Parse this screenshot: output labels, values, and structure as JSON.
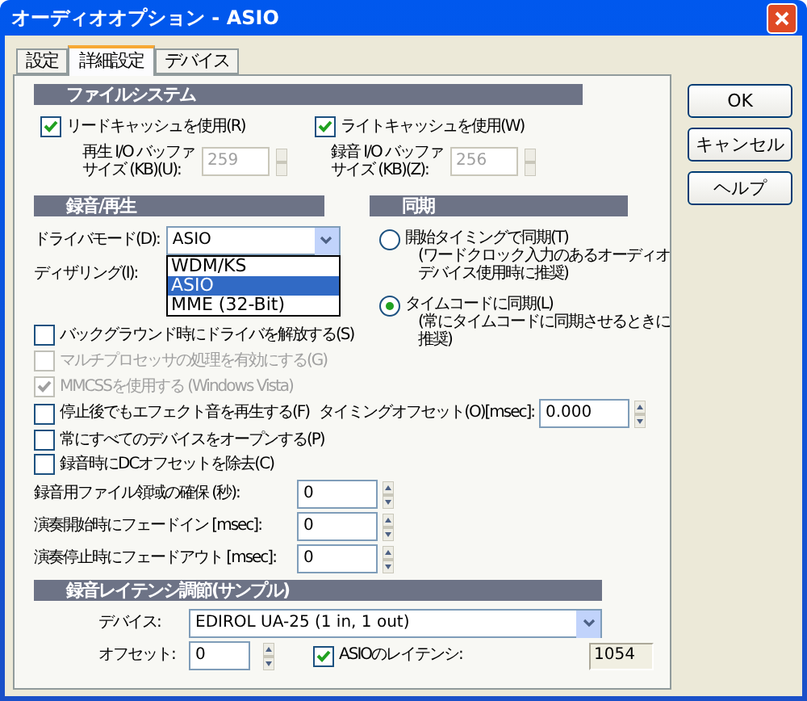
{
  "window": {
    "title": "オーディオオプション - ASIO"
  },
  "tabs": [
    {
      "label": "設定",
      "selected": false
    },
    {
      "label": "詳細設定",
      "selected": true
    },
    {
      "label": "デバイス",
      "selected": false
    }
  ],
  "buttons": [
    "OK",
    "キャンセル",
    "ヘルプ"
  ],
  "file_system": {
    "header": "ファイルシステム",
    "checkboxes": [
      {
        "label": "リードキャッシュを使用(R)",
        "checked": true
      },
      {
        "label": "ライトキャッシュを使用(W)",
        "checked": true
      }
    ],
    "buffers": [
      {
        "lines": [
          "再生 I/O バッファ",
          "サイズ (KB)(U):"
        ],
        "value": "259",
        "disabled": true
      },
      {
        "lines": [
          "録音 I/O バッファ",
          "サイズ (KB)(Z):"
        ],
        "value": "256",
        "disabled": true
      }
    ]
  },
  "recording": {
    "header": "録音/再生",
    "driver_mode": {
      "label": "ドライバモード(D):",
      "value": "ASIO",
      "options": [
        {
          "label": "WDM/KS",
          "selected": false
        },
        {
          "label": "ASIO",
          "selected": true
        },
        {
          "label": "MME (32-Bit)",
          "selected": false
        }
      ]
    },
    "dithering": {
      "label": "ディザリング(I):"
    },
    "checkboxes": [
      {
        "label": "バックグラウンド時にドライバを解放する(S)",
        "checked": false,
        "disabled": false
      },
      {
        "label": "マルチプロセッサの処理を有効にする(G)",
        "checked": false,
        "disabled": true
      },
      {
        "label": "MMCSSを使用する (Windows Vista)",
        "checked": true,
        "disabled": true
      },
      {
        "label": "停止後でもエフェクト音を再生する(F)",
        "checked": false,
        "disabled": false
      },
      {
        "label": "常にすべてのデバイスをオープンする(P)",
        "checked": false,
        "disabled": false
      },
      {
        "label": "録音時にDCオフセットを除去(C)",
        "checked": false,
        "disabled": false
      }
    ]
  },
  "sync": {
    "header": "同期",
    "radios": [
      {
        "lines": [
          "開始タイミングで同期(T)",
          "(ワードクロック入力のあるオーディオ",
          "デバイス使用時に推奨)"
        ],
        "selected": false
      },
      {
        "lines": [
          "タイムコードに同期(L)",
          "(常にタイムコードに同期させるときに",
          "推奨)"
        ],
        "selected": true
      }
    ],
    "timing_offset": {
      "label": "タイミングオフセット(O)[msec]:",
      "value": "0.000"
    }
  },
  "fields": [
    {
      "label": "録音用ファイル領域の確保 (秒):",
      "value": "0"
    },
    {
      "label": "演奏開始時にフェードイン [msec]:",
      "value": "0"
    },
    {
      "label": "演奏停止時にフェードアウト [msec]:",
      "value": "0"
    }
  ],
  "latency": {
    "header": "録音レイテンシ調節(サンプル)",
    "device": {
      "label": "デバイス:",
      "value": "EDIROL UA-25 (1 in, 1 out)"
    },
    "offset": {
      "label": "オフセット:",
      "value": "0"
    },
    "asio_latency": {
      "label": "ASIOのレイテンシ:",
      "checked": true,
      "value": "1054"
    }
  }
}
